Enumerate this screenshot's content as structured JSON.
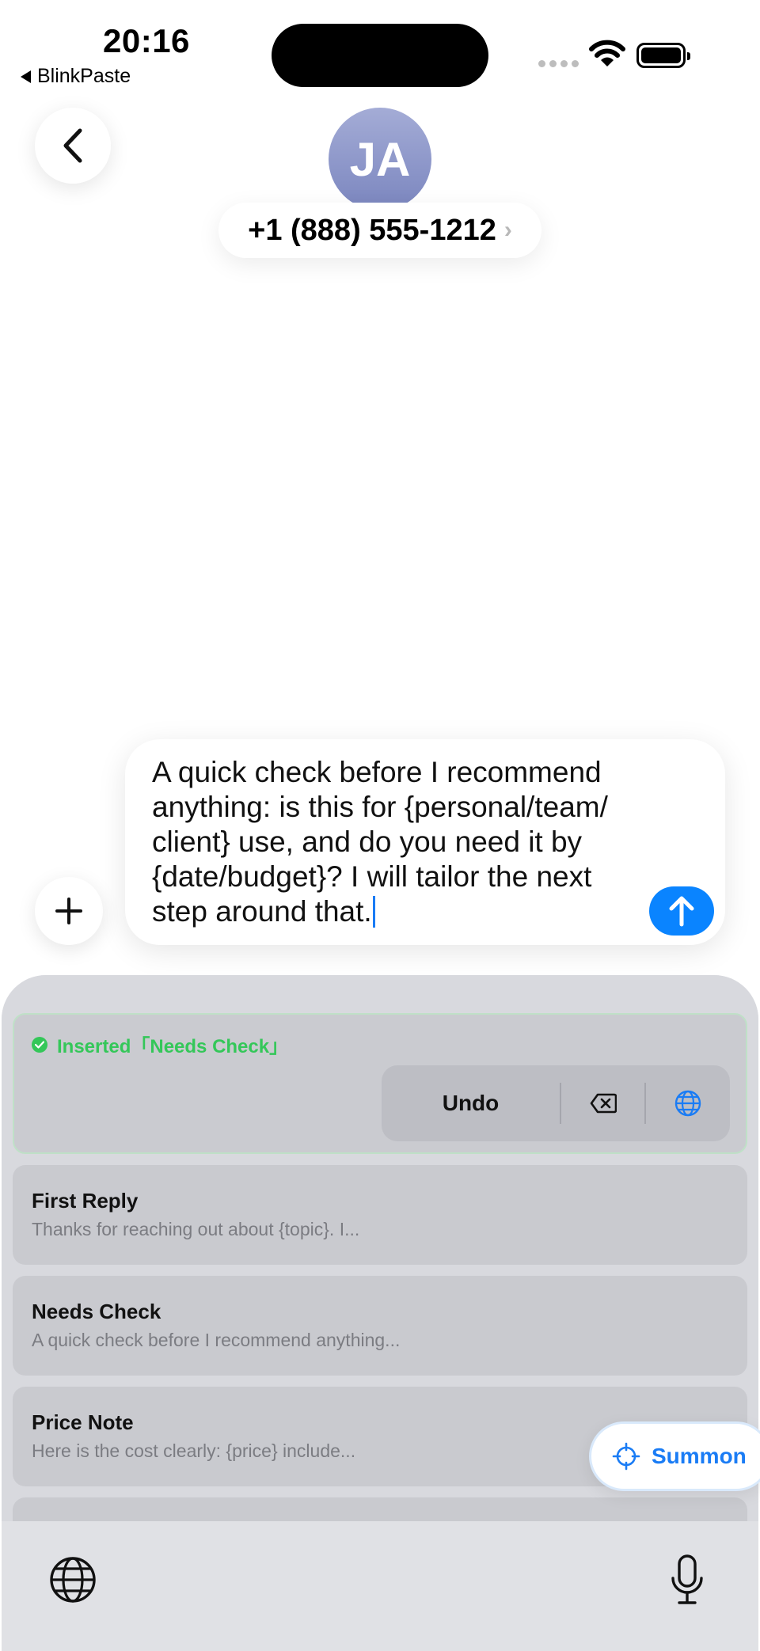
{
  "status_bar": {
    "time": "20:16",
    "back_app_label": "BlinkPaste"
  },
  "header": {
    "avatar_initials": "JA",
    "contact_number": "+1 (888) 555-1212",
    "contact_chevron": "›"
  },
  "compose": {
    "text": "A quick check before I recommend anything: is this for {personal/team/ client} use, and do you need it by {date/budget}? I will tailor the next step around that."
  },
  "keyboard": {
    "inserted_status": "Inserted「Needs Check」",
    "undo_label": "Undo",
    "snippets": [
      {
        "title": "First Reply",
        "preview": "Thanks for reaching out about {topic}. I..."
      },
      {
        "title": "Needs Check",
        "preview": "A quick check before I recommend anything..."
      },
      {
        "title": "Price Note",
        "preview": "Here is the cost clearly: {price} include..."
      }
    ],
    "summon_label": "Summon"
  },
  "colors": {
    "accent": "#0a84ff",
    "success": "#34c759",
    "avatar": "#8c96c9"
  }
}
